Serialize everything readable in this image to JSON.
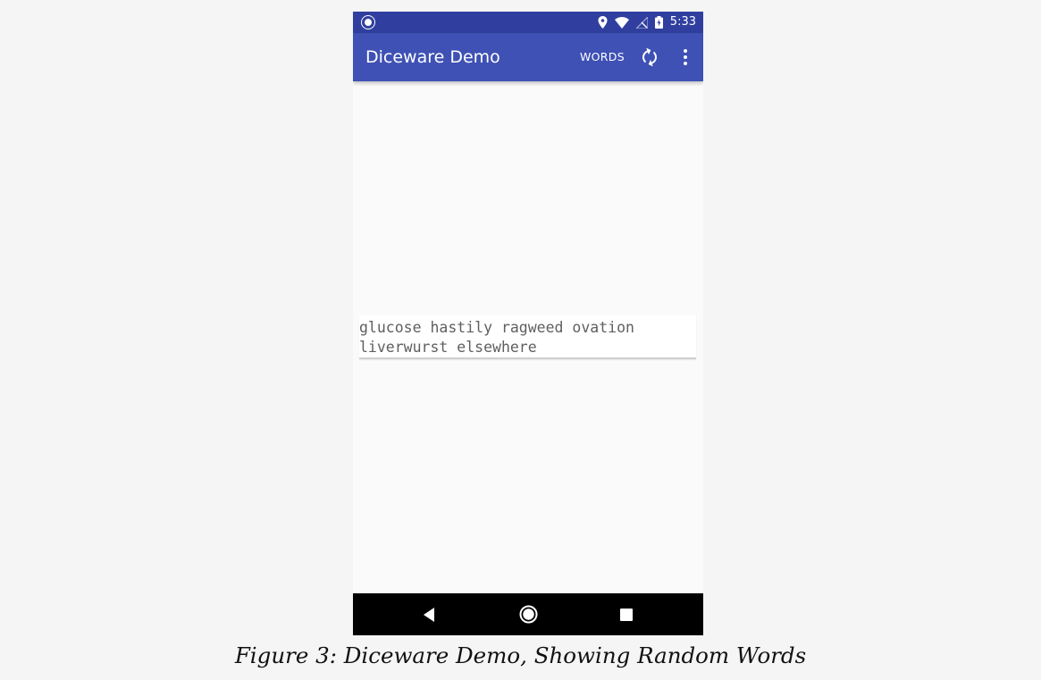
{
  "status_bar": {
    "time": "5:33",
    "icons": [
      "notification-dot-icon",
      "location-pin-icon",
      "wifi-icon",
      "no-signal-icon",
      "battery-charging-icon"
    ]
  },
  "app_bar": {
    "title": "Diceware Demo",
    "words_action_label": "WORDS",
    "refresh_icon": "refresh-icon",
    "overflow_icon": "more-vert-icon"
  },
  "main": {
    "passphrase": "glucose hastily ragweed ovation liverwurst elsewhere"
  },
  "nav_bar": {
    "icons": [
      "back-icon",
      "home-icon",
      "recents-icon"
    ]
  },
  "caption": "Figure 3: Diceware Demo, Showing Random Words",
  "colors": {
    "status_bar": "#303f9f",
    "app_bar": "#3f51b5",
    "background": "#fafafa",
    "nav_bar": "#000000"
  }
}
